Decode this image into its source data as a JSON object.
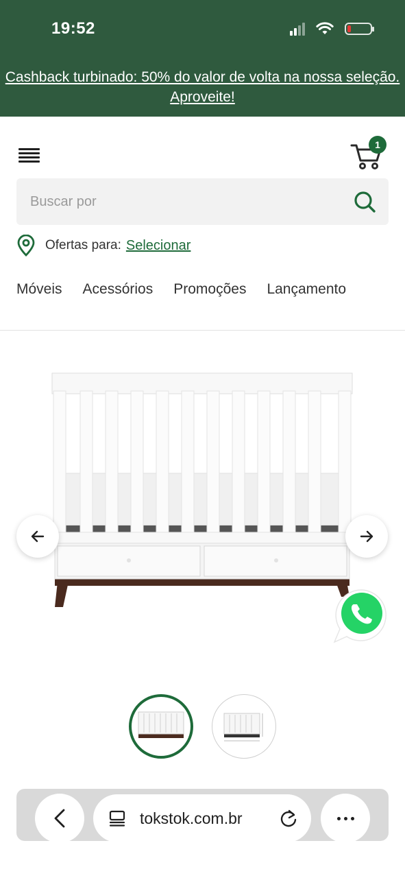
{
  "status_bar": {
    "time": "19:52"
  },
  "promo_banner": {
    "text": "Cashback turbinado: 50% do valor de volta na nossa seleção. Aproveite!"
  },
  "header": {
    "cart_count": "1"
  },
  "search": {
    "placeholder": "Buscar por"
  },
  "offers": {
    "label": "Ofertas para:",
    "link": "Selecionar"
  },
  "categories": [
    "Móveis",
    "Acessórios",
    "Promoções",
    "Lançamento"
  ],
  "browser": {
    "url": "tokstok.com.br"
  },
  "colors": {
    "brand_green": "#2f5a3e",
    "accent_green": "#1e6b3a",
    "whatsapp_green": "#25d366"
  },
  "icons": [
    "signal-icon",
    "wifi-icon",
    "battery-icon",
    "menu-icon",
    "cart-icon",
    "search-icon",
    "location-pin-icon",
    "arrow-left-icon",
    "arrow-right-icon",
    "whatsapp-icon",
    "chevron-left-icon",
    "tabs-icon",
    "reload-icon",
    "more-icon"
  ]
}
